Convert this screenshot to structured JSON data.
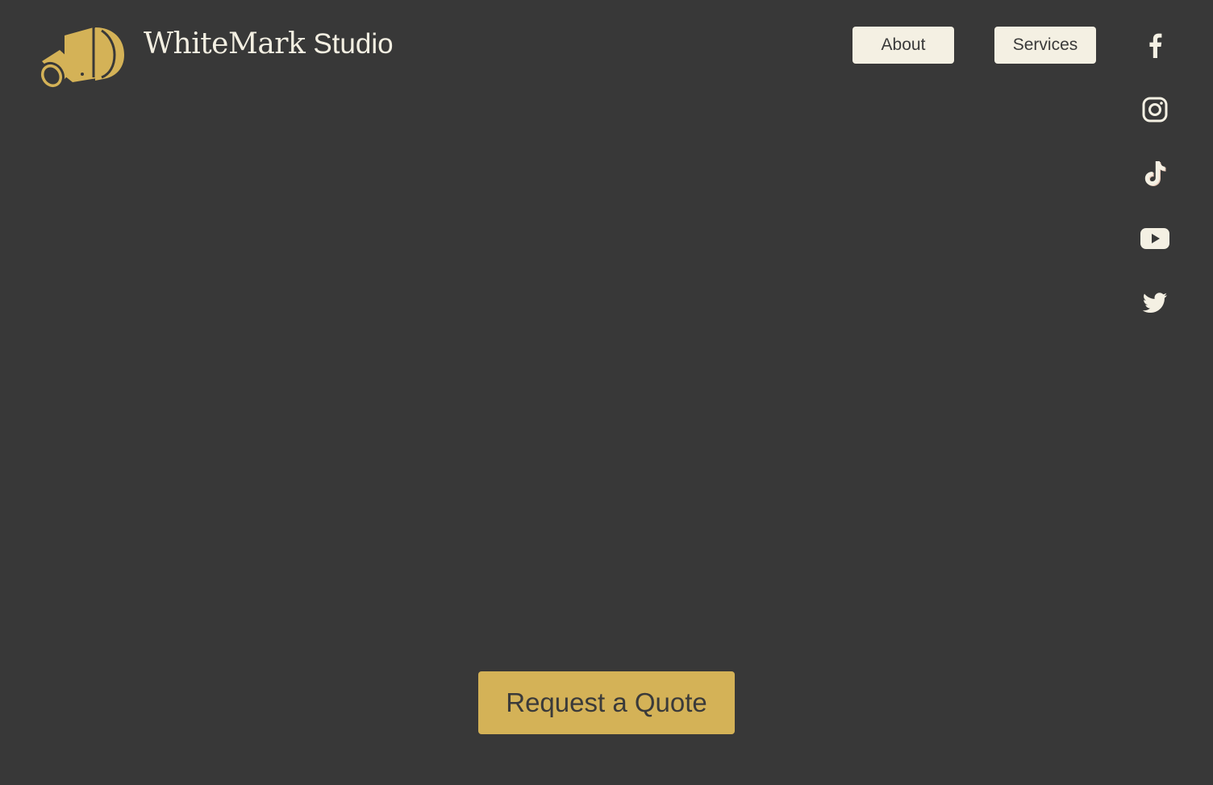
{
  "brand": {
    "name_primary": "WhiteMark",
    "name_secondary": "Studio",
    "logo_icon": "camera-logo-icon",
    "logo_color": "#d4b257"
  },
  "nav": {
    "items": [
      {
        "label": "About"
      },
      {
        "label": "Services"
      }
    ]
  },
  "social": [
    {
      "name": "facebook-icon"
    },
    {
      "name": "instagram-icon"
    },
    {
      "name": "tiktok-icon"
    },
    {
      "name": "youtube-icon"
    },
    {
      "name": "twitter-icon"
    }
  ],
  "cta": {
    "label": "Request a Quote",
    "color": "#d4b257"
  },
  "colors": {
    "background": "#383838",
    "nav_button_bg": "#f4f0e3",
    "text_light": "#f3efe2",
    "text_dark": "#3a3a3a"
  }
}
